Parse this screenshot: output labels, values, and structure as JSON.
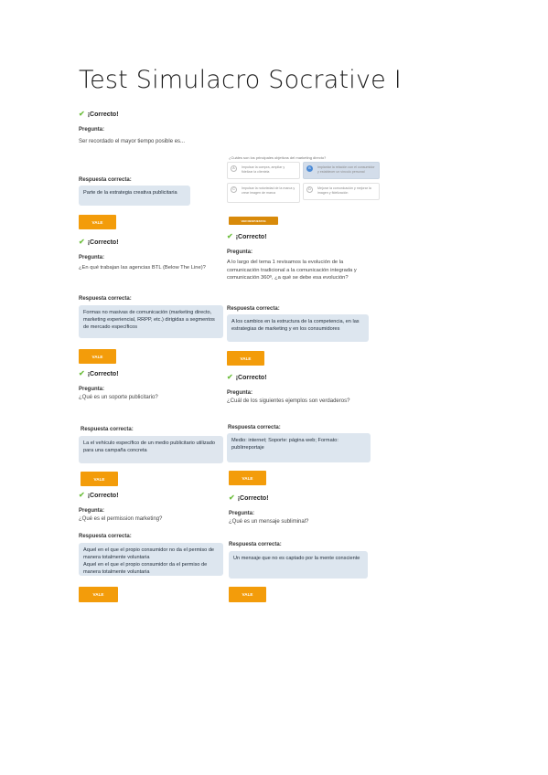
{
  "title": "Test Simulacro Socrative I",
  "correct_label": "¡Correcto!",
  "question_label": "Pregunta:",
  "answer_label": "Respuesta correcta:",
  "vale_label": "VALE",
  "cards": [
    {
      "correct": "¡Correcto!",
      "question_label": "Pregunta:",
      "question": "Ser recordado el mayor tiempo posible es...",
      "answer_label": "Respuesta correcta:",
      "answer": "Parte de la estrategia creativa publicitaria",
      "button": "VALE"
    },
    {
      "question": "¿Cuáles son los principales objetivos del marketing directo?",
      "options": [
        {
          "letter": "A",
          "text": "Impulsar la compra, ampliar y fidelizar la clientela"
        },
        {
          "letter": "B",
          "text": "Implantar la relación con el consumidor y establecer un vínculo personal"
        },
        {
          "letter": "C",
          "text": "Impulsar la notoriedad de la marca y crear imagen de marca"
        },
        {
          "letter": "D",
          "text": "Mejorar la comunicación y mejorar la imagen y fidelización"
        }
      ],
      "button": "VER RESPUESTAS"
    },
    {
      "correct": "¡Correcto!",
      "question_label": "Pregunta:",
      "question": "¿En qué trabajan las agencias BTL (Below The Line)?",
      "answer_label": "Respuesta correcta:",
      "answer": "Formas no masivas de comunicación (marketing directo, marketing experiencial, RRPP, etc.) dirigidas a segmentos de mercado específicos",
      "button": "VALE"
    },
    {
      "correct": "¡Correcto!",
      "question_label": "Pregunta:",
      "question": "A lo largo del tema 1 revisamos la evolución de la comunicación tradicional a la comunicación integrada y comunicación 360º, ¿a qué se debe esa evolución?",
      "answer_label": "Respuesta correcta:",
      "answer": "A los cambios en la estructura de la competencia, en las estrategias de marketing y en los consumidores",
      "button": "VALE"
    },
    {
      "correct": "¡Correcto!",
      "question_label": "Pregunta:",
      "question": "¿Qué es un soporte publicitario?",
      "answer_label": "Respuesta correcta:",
      "answer": "La el vehículo específico de un medio publicitario utilizado para una campaña concreta",
      "button": "VALE"
    },
    {
      "correct": "¡Correcto!",
      "question_label": "Pregunta:",
      "question": "¿Cuál de los siguientes ejemplos son verdaderos?",
      "answer_label": "Respuesta correcta:",
      "answer": "Medio: internet; Soporte: página web; Formato: publirreportaje",
      "button": "VALE"
    },
    {
      "correct": "¡Correcto!",
      "question_label": "Pregunta:",
      "question": "¿Qué es el permission marketing?",
      "answer_label": "Respuesta correcta:",
      "answer_lines": [
        "Aquel en el que el propio consumidor no da el permiso de manera totalmente voluntaria",
        "Aquel en el que el propio consumidor da el permiso de manera totalmente voluntaria"
      ],
      "button": "VALE"
    },
    {
      "correct": "¡Correcto!",
      "question_label": "Pregunta:",
      "question": "¿Qué es un mensaje subliminal?",
      "answer_label": "Respuesta correcta:",
      "answer": "Un mensaje que no es captado por la mente consciente",
      "button": "VALE"
    }
  ],
  "colors": {
    "accent": "#f39c0a",
    "check": "#6fbf40",
    "answer_bg": "#dde6ef",
    "selected_option": "#d3ddea"
  }
}
